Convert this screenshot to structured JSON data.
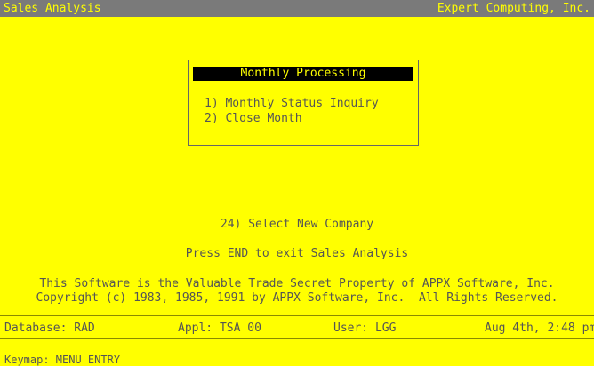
{
  "titlebar": {
    "app_name": "Sales Analysis",
    "company": "Expert Computing, Inc."
  },
  "menu": {
    "title": "Monthly Processing",
    "options": [
      "1) Monthly Status Inquiry",
      "2) Close Month"
    ]
  },
  "select_company": "24) Select New Company",
  "exit_hint": "Press END to exit Sales Analysis",
  "legal": {
    "line1": "This Software is the Valuable Trade Secret Property of APPX Software, Inc.",
    "line2": "Copyright (c) 1983, 1985, 1991 by APPX Software, Inc.  All Rights Reserved."
  },
  "status": {
    "database": "Database: RAD",
    "appl": "Appl: TSA 00",
    "user": "User: LGG",
    "datetime": "Aug 4th, 2:48 pm"
  },
  "keymap": "Keymap: MENU ENTRY",
  "colors": {
    "background": "#ffff00",
    "titlebar": "#7a7a7a",
    "text": "#555555",
    "menu_title_bg": "#000000"
  }
}
